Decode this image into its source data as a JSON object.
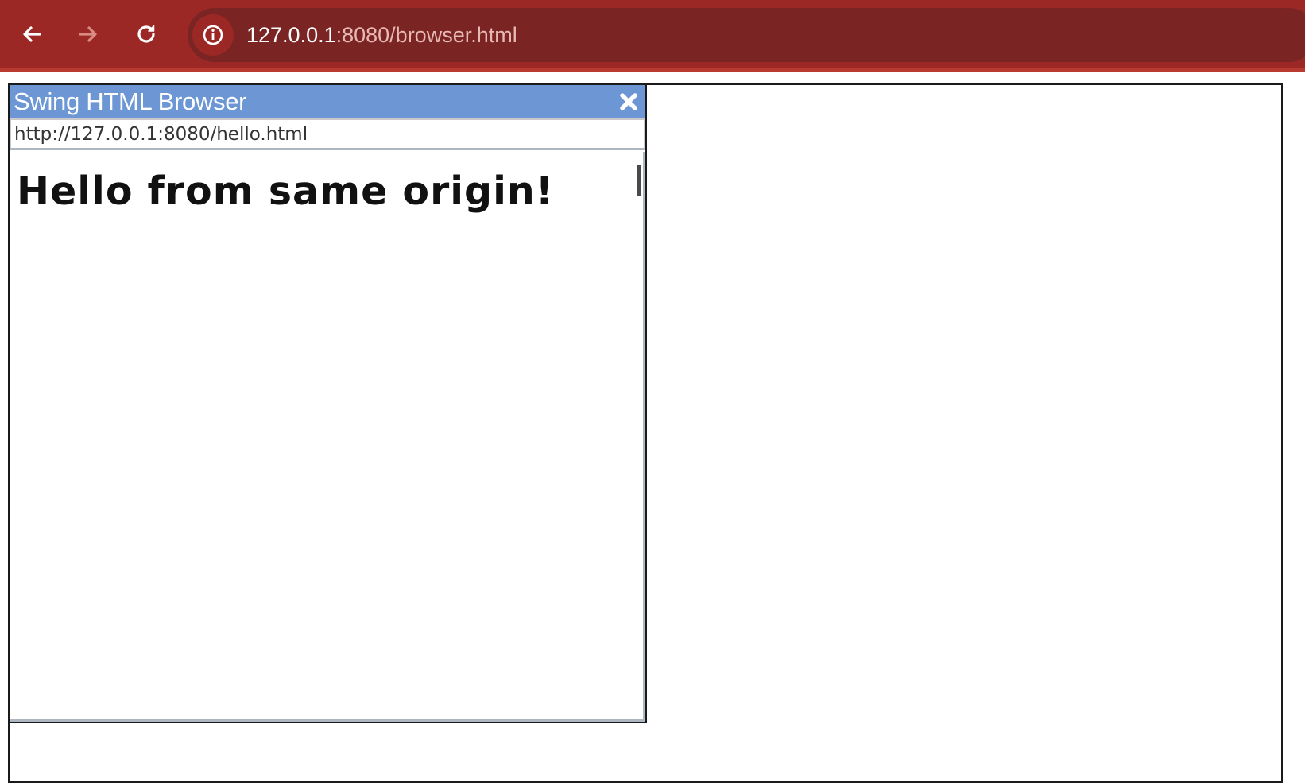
{
  "browser": {
    "url_host": "127.0.0.1",
    "url_rest": ":8080/browser.html",
    "icons": {
      "back": "arrow-left-icon",
      "forward": "arrow-right-icon",
      "reload": "reload-icon",
      "site_info": "info-circle-icon"
    },
    "colors": {
      "toolbar": "#9b2824",
      "omnibox": "#7a2423"
    }
  },
  "swing_window": {
    "title": "Swing HTML Browser",
    "close_icon": "close-x-icon",
    "address": "http://127.0.0.1:8080/hello.html",
    "content_heading": "Hello from same origin!",
    "colors": {
      "titlebar": "#6c97d4"
    }
  }
}
